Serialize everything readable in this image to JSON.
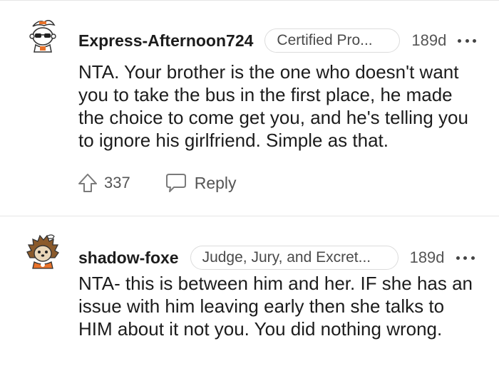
{
  "comments": [
    {
      "username": "Express-Afternoon724",
      "flair": "Certified Pro...",
      "age": "189d",
      "body": "NTA. Your brother is the one who doesn't want you to take the bus in the first place, he made the choice to come get you, and he's telling you to ignore his girlfriend. Simple as that.",
      "upvotes": "337",
      "reply_label": "Reply"
    },
    {
      "username": "shadow-foxe",
      "flair": "Judge, Jury, and Excret...",
      "age": "189d",
      "body": "NTA- this is between him and her. IF she has an issue with him leaving early then she talks to HIM about it not you. You did nothing wrong."
    }
  ],
  "icons": {
    "more": "more-options-icon",
    "upvote": "upvote-arrow-icon",
    "reply": "speech-bubble-icon"
  },
  "colors": {
    "text": "#1c1c1c",
    "muted": "#555555",
    "separator": "#e6e6e6",
    "avatar_orange": "#e8722a"
  }
}
